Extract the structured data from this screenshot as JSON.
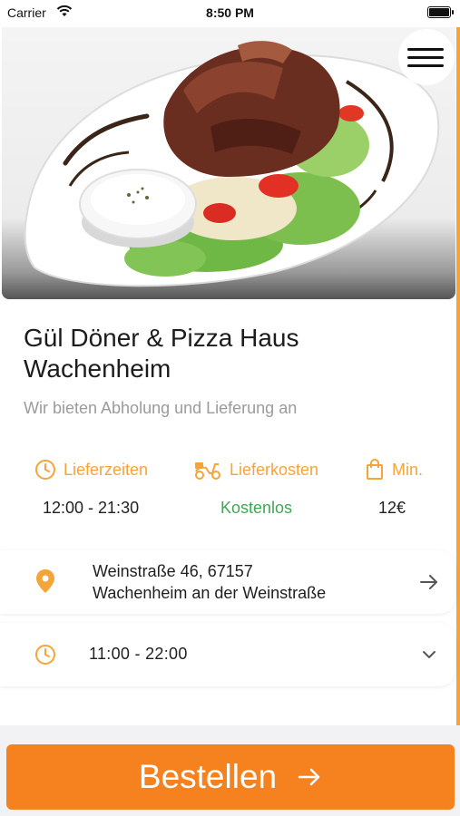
{
  "status_bar": {
    "carrier": "Carrier",
    "time": "8:50 PM"
  },
  "restaurant": {
    "name_line1": "Gül Döner & Pizza Haus",
    "name_line2": "Wachenheim",
    "subtitle": "Wir bieten Abholung und Lieferung an"
  },
  "info": {
    "delivery_times_label": "Lieferzeiten",
    "delivery_times_value": "12:00 - 21:30",
    "delivery_cost_label": "Lieferkosten",
    "delivery_cost_value": "Kostenlos",
    "min_label": "Min.",
    "min_value": "12€"
  },
  "address": {
    "line1": "Weinstraße 46, 67157",
    "line2": "Wachenheim an der Weinstraße"
  },
  "hours": {
    "today": "11:00 - 22:00"
  },
  "order_button": {
    "label": "Bestellen"
  },
  "icons": {
    "menu": "hamburger-menu-icon",
    "clock": "clock-icon",
    "scooter": "scooter-icon",
    "bag": "shopping-bag-icon",
    "pin": "location-pin-icon",
    "arrow": "arrow-right-icon",
    "chevron": "chevron-down-icon"
  },
  "colors": {
    "accent": "#f5a43a",
    "button": "#f6821f",
    "free": "#3fa654",
    "subtitle": "#9b9b9b"
  }
}
